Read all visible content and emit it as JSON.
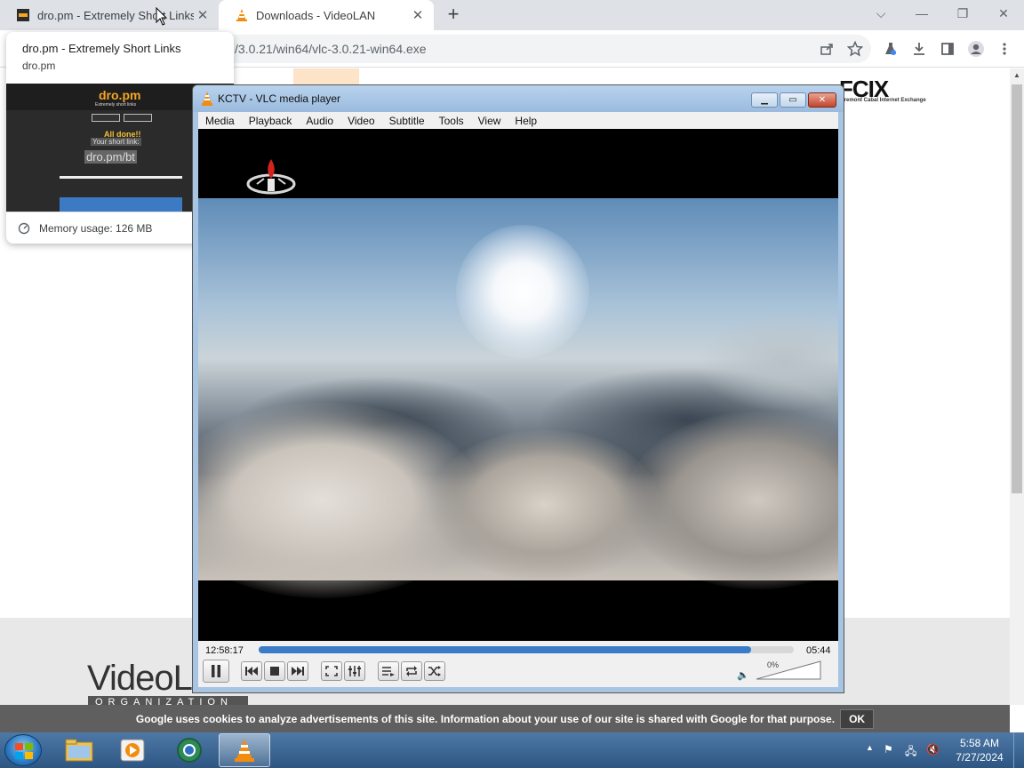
{
  "browser": {
    "tabs": [
      {
        "title": "dro.pm - Extremely Short Links",
        "close": "✕"
      },
      {
        "title": "Downloads - VideoLAN",
        "close": "✕"
      }
    ],
    "new_tab": "+",
    "url": "/3.0.21/win64/vlc-3.0.21-win64.exe",
    "window_controls": {
      "dropdown": "⌵",
      "minimize": "—",
      "restore": "❐",
      "close": "✕"
    }
  },
  "hover_card": {
    "title": "dro.pm - Extremely Short Links",
    "domain": "dro.pm",
    "memory": "Memory usage: 126 MB",
    "thumbnail": {
      "logo": "dro.pm",
      "subtitle": "Extremely short links",
      "all_done": "All done!!",
      "your_link": "Your short link:",
      "link": "dro.pm/bt"
    }
  },
  "page": {
    "fcix": "FCIX",
    "fcix_sub": "Fremont Cabal Internet Exchange",
    "videolan_logo": "VideoL",
    "videolan_org": "ORGANIZATION",
    "cookie_text": "Google uses cookies to analyze advertisements of this site. Information about your use of our site is shared with Google for that purpose.",
    "cookie_ok": "OK"
  },
  "vlc": {
    "title": "KCTV - VLC media player",
    "menu": [
      "Media",
      "Playback",
      "Audio",
      "Video",
      "Subtitle",
      "Tools",
      "View",
      "Help"
    ],
    "elapsed": "12:58:17",
    "total": "05:44",
    "progress": 0.92,
    "volume": "0%",
    "title_buttons": {
      "minimize": "▁",
      "maximize": "▭",
      "close": "✕"
    }
  },
  "taskbar": {
    "time": "5:58 AM",
    "date": "7/27/2024"
  },
  "colors": {
    "accent_blue": "#3a7cc8",
    "vlc_orange": "#f28c0f",
    "taskbar": "#2d5683"
  }
}
